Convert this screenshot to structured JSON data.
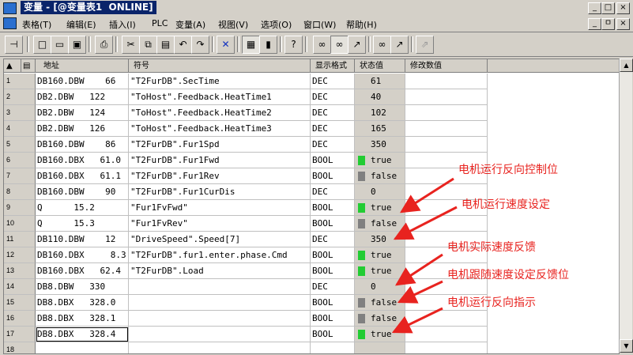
{
  "window": {
    "title": "变量 - [@变量表1  ONLINE]",
    "min_label": "_",
    "max_label": "□",
    "close_label": "×",
    "restore_label": "ㅁ"
  },
  "menu": [
    "表格(T)",
    "编辑(E)",
    "插入(I)",
    "PLC",
    "变量(A)",
    "视图(V)",
    "选项(O)",
    "窗口(W)",
    "帮助(H)"
  ],
  "toolbar_icons": [
    "pin-icon",
    "new-icon",
    "open-icon",
    "save-icon",
    "print-icon",
    "cut-icon",
    "copy-icon",
    "paste-icon",
    "undo-icon",
    "redo-icon",
    "delete-icon",
    "monitor-icon",
    "plc-icon",
    "help-icon",
    "glasses-icon",
    "glasses-double-icon",
    "modify-icon",
    "trigger-icon",
    "trigger-modify-icon",
    "force-icon"
  ],
  "columns": [
    "地址",
    "符号",
    "显示格式",
    "状态值",
    "修改数值"
  ],
  "rows": [
    {
      "n": "1",
      "addr": "DB160.DBW    66",
      "sym": "\"T2FurDB\".SecTime",
      "fmt": "DEC",
      "val": "61",
      "flag": ""
    },
    {
      "n": "2",
      "addr": "DB2.DBW   122",
      "sym": "\"ToHost\".Feedback.HeatTime1",
      "fmt": "DEC",
      "val": "40",
      "flag": ""
    },
    {
      "n": "3",
      "addr": "DB2.DBW   124",
      "sym": "\"ToHost\".Feedback.HeatTime2",
      "fmt": "DEC",
      "val": "102",
      "flag": ""
    },
    {
      "n": "4",
      "addr": "DB2.DBW   126",
      "sym": "\"ToHost\".Feedback.HeatTime3",
      "fmt": "DEC",
      "val": "165",
      "flag": ""
    },
    {
      "n": "5",
      "addr": "DB160.DBW    86",
      "sym": "\"T2FurDB\".Fur1Spd",
      "fmt": "DEC",
      "val": "350",
      "flag": ""
    },
    {
      "n": "6",
      "addr": "DB160.DBX   61.0",
      "sym": "\"T2FurDB\".Fur1Fwd",
      "fmt": "BOOL",
      "val": "true",
      "flag": "true"
    },
    {
      "n": "7",
      "addr": "DB160.DBX   61.1",
      "sym": "\"T2FurDB\".Fur1Rev",
      "fmt": "BOOL",
      "val": "false",
      "flag": "false"
    },
    {
      "n": "8",
      "addr": "DB160.DBW    90",
      "sym": "\"T2FurDB\".Fur1CurDis",
      "fmt": "DEC",
      "val": "0",
      "flag": ""
    },
    {
      "n": "9",
      "addr": "Q      15.2",
      "sym": "\"Fur1FvFwd\"",
      "fmt": "BOOL",
      "val": "true",
      "flag": "true"
    },
    {
      "n": "10",
      "addr": "Q      15.3",
      "sym": "\"Fur1FvRev\"",
      "fmt": "BOOL",
      "val": "false",
      "flag": "false"
    },
    {
      "n": "11",
      "addr": "DB110.DBW    12",
      "sym": "\"DriveSpeed\".Speed[7]",
      "fmt": "DEC",
      "val": "350",
      "flag": ""
    },
    {
      "n": "12",
      "addr": "DB160.DBX     8.3",
      "sym": "\"T2FurDB\".fur1.enter.phase.Cmd",
      "fmt": "BOOL",
      "val": "true",
      "flag": "true"
    },
    {
      "n": "13",
      "addr": "DB160.DBX   62.4",
      "sym": "\"T2FurDB\".Load",
      "fmt": "BOOL",
      "val": "true",
      "flag": "true"
    },
    {
      "n": "14",
      "addr": "DB8.DBW   330",
      "sym": "",
      "fmt": "DEC",
      "val": "0",
      "flag": ""
    },
    {
      "n": "15",
      "addr": "DB8.DBX   328.0",
      "sym": "",
      "fmt": "BOOL",
      "val": "false",
      "flag": "false"
    },
    {
      "n": "16",
      "addr": "DB8.DBX   328.1",
      "sym": "",
      "fmt": "BOOL",
      "val": "false",
      "flag": "false"
    },
    {
      "n": "17",
      "addr": "DB8.DBX   328.4",
      "sym": "",
      "fmt": "BOOL",
      "val": "true",
      "flag": "true"
    },
    {
      "n": "18",
      "addr": "",
      "sym": "",
      "fmt": "",
      "val": "",
      "flag": ""
    }
  ],
  "annotations": [
    "电机运行反向控制位",
    "电机运行速度设定",
    "电机实际速度反馈",
    "电机跟随速度设定反馈位",
    "电机运行反向指示"
  ],
  "colors": {
    "true_flag": "#22cc33",
    "false_flag": "#808080",
    "annotation": "#e8231f",
    "title_bg": "#0a246a"
  }
}
